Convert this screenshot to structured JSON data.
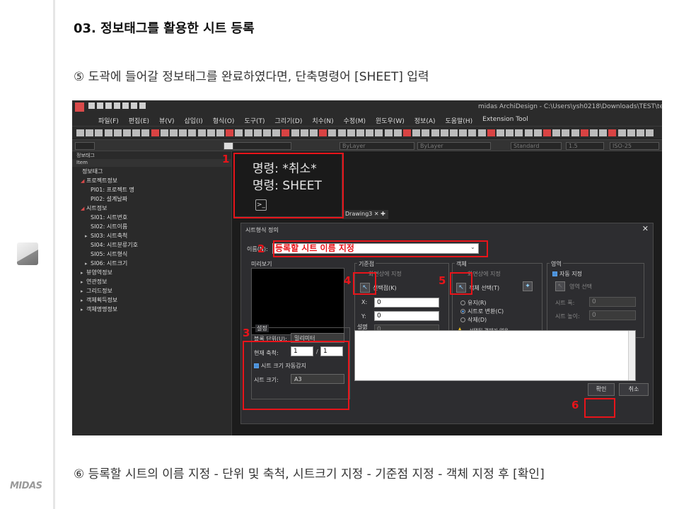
{
  "page": {
    "title": "03. 정보태그를 활용한 시트 등록",
    "step5": "⑤ 도곽에 들어갈 정보태그를 완료하였다면, 단축명령어 [SHEET] 입력",
    "step6": "⑥ 등록할 시트의 이름 지정 - 단위 및 축척, 시트크기 지정 - 기준점 지정 - 객체 지정 후 [확인]",
    "logo": "MIDAS"
  },
  "app": {
    "window_title": "midas ArchiDesign - C:\\Users\\ysh0218\\Downloads\\TEST\\test.mdwg",
    "menu": [
      "파일(F)",
      "편집(E)",
      "뷰(V)",
      "삽입(I)",
      "형식(O)",
      "도구(T)",
      "그리기(D)",
      "치수(N)",
      "수정(M)",
      "윈도우(W)",
      "정보(A)",
      "도움말(H)",
      "Extension Tool"
    ],
    "props": {
      "layer1": "ByLayer",
      "layer2": "ByLayer",
      "layer3": "ByLayer",
      "style": "Standard",
      "scale": "1.5",
      "dim": "ISO-25"
    }
  },
  "panel": {
    "header": "정보태그",
    "col": "Item",
    "tree": [
      {
        "label": "정보태그",
        "level": 0,
        "arrow": ""
      },
      {
        "label": "프로젝트정보",
        "level": 1,
        "arrow": "◢"
      },
      {
        "label": "PI01: 프로젝트 명",
        "level": 2,
        "arrow": ""
      },
      {
        "label": "PI02: 설계날짜",
        "level": 2,
        "arrow": ""
      },
      {
        "label": "시트정보",
        "level": 1,
        "arrow": "◢"
      },
      {
        "label": "SI01: 시트번호",
        "level": 2,
        "arrow": ""
      },
      {
        "label": "SI02: 시트이름",
        "level": 2,
        "arrow": ""
      },
      {
        "label": "SI03: 시트축척",
        "level": 2,
        "arrow": "▸"
      },
      {
        "label": "SI04: 시트분류기호",
        "level": 2,
        "arrow": ""
      },
      {
        "label": "SI05: 시트형식",
        "level": 2,
        "arrow": ""
      },
      {
        "label": "SI06: 시트크기",
        "level": 2,
        "arrow": "▸"
      },
      {
        "label": "뷰영역정보",
        "level": 1,
        "arrow": "▸"
      },
      {
        "label": "연관정보",
        "level": 1,
        "arrow": "▸"
      },
      {
        "label": "그리드정보",
        "level": 1,
        "arrow": "▸"
      },
      {
        "label": "객체획득정보",
        "level": 1,
        "arrow": "▸"
      },
      {
        "label": "객체명명정보",
        "level": 1,
        "arrow": "▸"
      }
    ]
  },
  "command": {
    "line1": "명령: *취소*",
    "line2": "명령: SHEET",
    "prompt_icon": ">_"
  },
  "drawing_tab": "Drawing3 ✕ ✚",
  "dialog": {
    "title": "시트형식 정의",
    "name_label": "이름(N):",
    "name_value": "등록할 시트 이름 지정",
    "preview_label": "미리보기",
    "base_group": "기준점",
    "base_onscreen": "화면상에 지정",
    "base_pick": "선택점(K)",
    "x_label": "X:",
    "x_value": "0",
    "y_label": "Y:",
    "y_value": "0",
    "z_label": "Z:",
    "z_value": "0",
    "obj_group": "객체",
    "obj_onscreen": "화면상에 지정",
    "obj_select": "객체 선택(T)",
    "obj_opt1": "유지(R)",
    "obj_opt2": "시트로 변환(C)",
    "obj_opt3": "삭제(D)",
    "obj_warning": "선택된 객체가 없음.",
    "area_group": "영역",
    "area_auto": "자동 지정",
    "area_select": "영역 선택",
    "area_width_label": "시트 폭:",
    "area_width": "0",
    "area_height_label": "시트 높이:",
    "area_height": "0",
    "settings_group": "설정",
    "unit_label": "블록 단위(U):",
    "unit_value": "밀리미터",
    "scale_label": "현재 축척:",
    "scale_a": "1",
    "scale_sep": "/",
    "scale_b": "1",
    "autosize_label": "시트 크기 자동감지",
    "size_label": "시트 크기:",
    "size_value": "A3",
    "desc_label": "설명",
    "ok": "확인",
    "cancel": "취소"
  },
  "markers": [
    "1",
    "2",
    "3",
    "4",
    "5",
    "6"
  ],
  "colors": {
    "highlight": "#e8141a",
    "checkbox": "#4a90d9"
  }
}
